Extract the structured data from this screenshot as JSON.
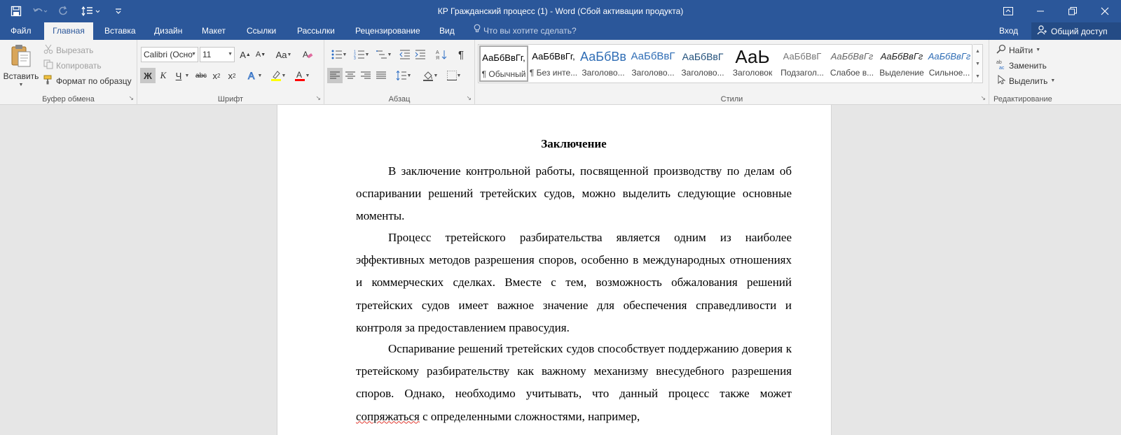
{
  "window": {
    "title": "КР Гражданский процесс (1) - Word (Сбой активации продукта)"
  },
  "quick_access": {
    "save_icon": "save-icon",
    "undo_icon": "undo-icon",
    "redo_icon": "redo-icon",
    "line_spacing_icon": "line-spacing-icon"
  },
  "tabs": [
    {
      "label": "Файл"
    },
    {
      "label": "Главная"
    },
    {
      "label": "Вставка"
    },
    {
      "label": "Дизайн"
    },
    {
      "label": "Макет"
    },
    {
      "label": "Ссылки"
    },
    {
      "label": "Рассылки"
    },
    {
      "label": "Рецензирование"
    },
    {
      "label": "Вид"
    }
  ],
  "tell_me": "Что вы хотите сделать?",
  "sign_in": "Вход",
  "share": "Общий доступ",
  "clipboard": {
    "paste": "Вставить",
    "cut": "Вырезать",
    "copy": "Копировать",
    "format_painter": "Формат по образцу",
    "label": "Буфер обмена"
  },
  "font": {
    "name": "Calibri (Осно",
    "size": "11",
    "bold": "Ж",
    "italic": "К",
    "underline": "Ч",
    "strike": "abc",
    "label": "Шрифт"
  },
  "paragraph": {
    "label": "Абзац"
  },
  "styles": {
    "label": "Стили",
    "items": [
      {
        "sample": "АаБбВвГг,",
        "name": "¶ Обычный"
      },
      {
        "sample": "АаБбВвГг,",
        "name": "¶ Без инте..."
      },
      {
        "sample": "АаБбВв",
        "name": "Заголово..."
      },
      {
        "sample": "АаБбВвГ",
        "name": "Заголово..."
      },
      {
        "sample": "АаБбВвГ",
        "name": "Заголово..."
      },
      {
        "sample": "АаЬ",
        "name": "Заголовок"
      },
      {
        "sample": "АаБбВвГ",
        "name": "Подзагол..."
      },
      {
        "sample": "АаБбВвГг",
        "name": "Слабое в..."
      },
      {
        "sample": "АаБбВвГг",
        "name": "Выделение"
      },
      {
        "sample": "АаБбВвГг",
        "name": "Сильное..."
      }
    ]
  },
  "editing": {
    "find": "Найти",
    "replace": "Заменить",
    "select": "Выделить",
    "label": "Редактирование"
  },
  "document": {
    "heading": "Заключение",
    "p1": "В заключение контрольной работы, посвященной производству по делам об оспаривании решений третейских судов, можно выделить следующие основные моменты.",
    "p2": "Процесс третейского разбирательства является одним из наиболее эффективных методов разрешения споров, особенно в международных отношениях и коммерческих сделках. Вместе с тем, возможность обжалования решений третейских судов имеет важное значение для обеспечения справедливости и контроля за предоставлением правосудия.",
    "p3_a": "Оспаривание решений третейских судов способствует поддержанию доверия к третейскому разбирательству как важному механизму внесудебного разрешения споров. Однако, необходимо учитывать, что данный процесс также может ",
    "p3_spell": "сопряжаться",
    "p3_b": " с определенными сложностями, например,"
  },
  "colors": {
    "accent": "#2b579a",
    "highlight": "#ffff00",
    "font_color": "#ff0000"
  }
}
